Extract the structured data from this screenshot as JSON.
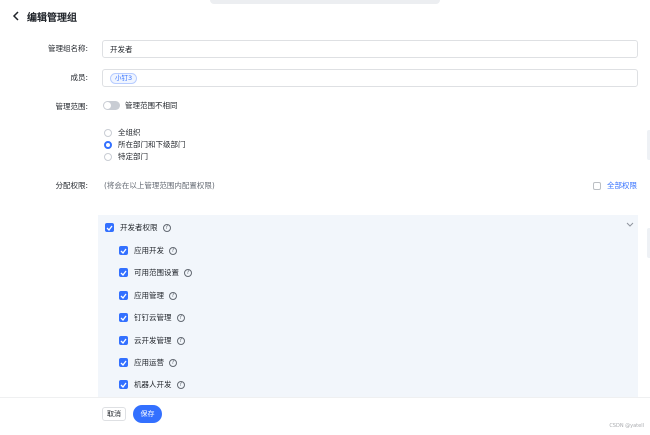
{
  "header": {
    "title": "编辑管理组"
  },
  "form": {
    "name_label": "管理组名称:",
    "name_value": "开发者",
    "members_label": "成员:",
    "member_tag": "小钉3",
    "scope_label": "管理范围:",
    "scope_toggle_label": "管理范围不相同",
    "scope_toggle_on": false,
    "scope_options": [
      {
        "label": "全组织",
        "checked": false
      },
      {
        "label": "所在部门和下级部门",
        "checked": true
      },
      {
        "label": "特定部门",
        "checked": false
      }
    ],
    "permissions_label": "分配权限:",
    "permissions_hint": "(将会在以上管理范围内配置权限)",
    "all_permissions_label": "全部权限"
  },
  "permissions": {
    "group_label": "开发者权限",
    "items": [
      {
        "label": "应用开发"
      },
      {
        "label": "可用范围设置"
      },
      {
        "label": "应用管理"
      },
      {
        "label": "钉钉云管理"
      },
      {
        "label": "云开发管理"
      },
      {
        "label": "应用运营"
      },
      {
        "label": "机器人开发"
      }
    ]
  },
  "footer": {
    "cancel_label": "取消",
    "save_label": "保存"
  },
  "watermark": "CSDN @yatell",
  "colors": {
    "accent": "#3370ff",
    "panel_bg": "#f2f6fb",
    "border": "#dee0e3"
  },
  "icons": [
    "back-chevron-icon",
    "question-icon",
    "checkbox-checked-icon",
    "chevron-down-icon"
  ]
}
